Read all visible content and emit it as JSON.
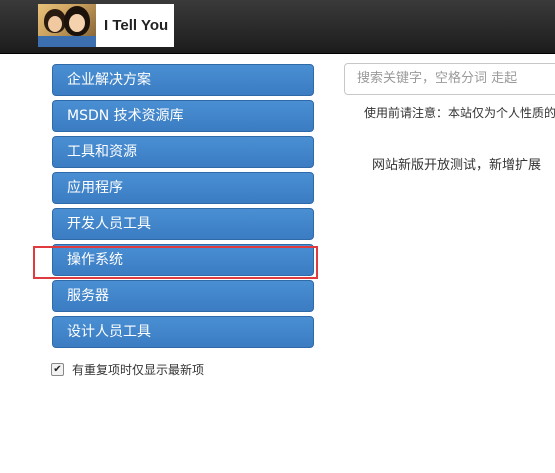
{
  "header": {
    "brand_name": "I Tell You"
  },
  "sidebar": {
    "items": [
      {
        "label": "企业解决方案"
      },
      {
        "label": "MSDN 技术资源库"
      },
      {
        "label": "工具和资源"
      },
      {
        "label": "应用程序"
      },
      {
        "label": "开发人员工具"
      },
      {
        "label": "操作系统"
      },
      {
        "label": "服务器"
      },
      {
        "label": "设计人员工具"
      }
    ],
    "highlighted_item": "操作系统",
    "checkbox": {
      "checked": true,
      "mark": "✔",
      "label": "有重复项时仅显示最新项"
    }
  },
  "main": {
    "search_placeholder": "搜索关键字，空格分词 走起",
    "notice": "使用前请注意：本站仅为个人性质的",
    "news": "网站新版开放测试，新增扩展"
  },
  "colors": {
    "menu_item_bg": "#3b7cc2",
    "highlight_border": "#e0393e",
    "topbar_bg": "#1c1c1c"
  }
}
